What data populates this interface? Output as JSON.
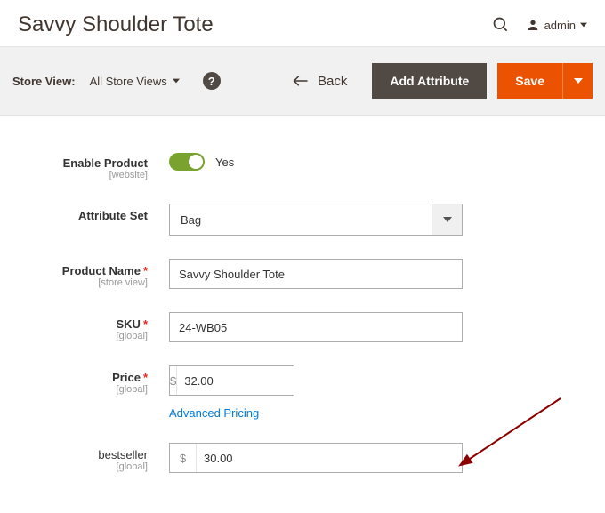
{
  "header": {
    "title": "Savvy Shoulder Tote",
    "admin_label": "admin"
  },
  "toolbar": {
    "store_view_label": "Store View:",
    "store_view_value": "All Store Views",
    "back_label": "Back",
    "add_attribute_label": "Add Attribute",
    "save_label": "Save"
  },
  "form": {
    "enable_product": {
      "label": "Enable Product",
      "scope": "[website]",
      "value_text": "Yes"
    },
    "attribute_set": {
      "label": "Attribute Set",
      "value": "Bag"
    },
    "product_name": {
      "label": "Product Name",
      "scope": "[store view]",
      "value": "Savvy Shoulder Tote"
    },
    "sku": {
      "label": "SKU",
      "scope": "[global]",
      "value": "24-WB05"
    },
    "price": {
      "label": "Price",
      "scope": "[global]",
      "currency": "$",
      "value": "32.00",
      "advanced_link": "Advanced Pricing"
    },
    "bestseller": {
      "label": "bestseller",
      "scope": "[global]",
      "currency": "$",
      "value": "30.00"
    }
  }
}
